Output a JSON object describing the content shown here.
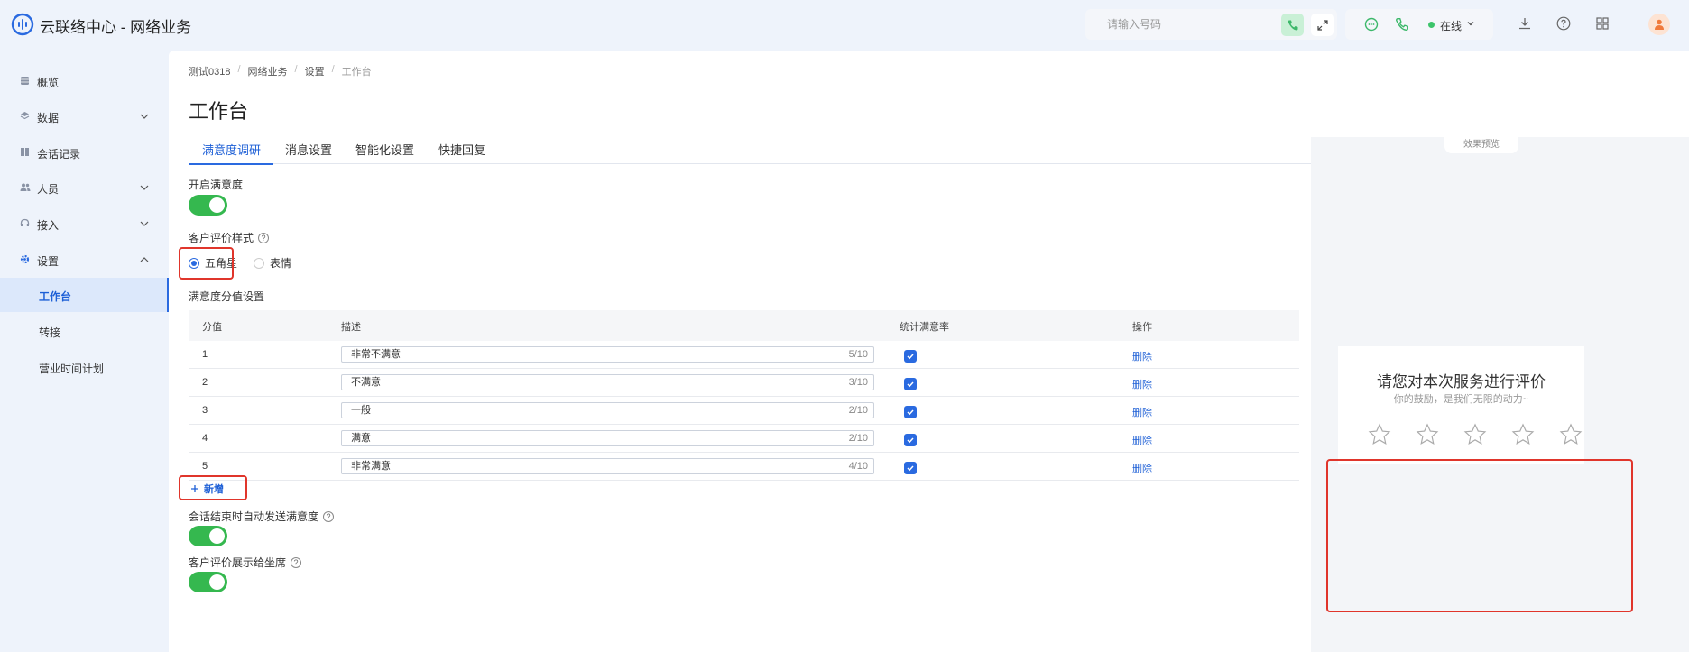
{
  "header": {
    "app_title": "云联络中心 - 网络业务",
    "phone_placeholder": "请输入号码",
    "status": "在线"
  },
  "sidebar": {
    "items": [
      {
        "label": "概览"
      },
      {
        "label": "数据"
      },
      {
        "label": "会话记录"
      },
      {
        "label": "人员"
      },
      {
        "label": "接入"
      },
      {
        "label": "设置"
      },
      {
        "label": "工作台"
      },
      {
        "label": "转接"
      },
      {
        "label": "营业时间计划"
      }
    ]
  },
  "breadcrumb": [
    "测试0318",
    "网络业务",
    "设置",
    "工作台"
  ],
  "page_title": "工作台",
  "tabs": [
    "满意度调研",
    "消息设置",
    "智能化设置",
    "快捷回复"
  ],
  "form": {
    "enable_label": "开启满意度",
    "style_label": "客户评价样式",
    "style_options": [
      "五角星",
      "表情"
    ],
    "score_settings_label": "满意度分值设置",
    "auto_send_label": "会话结束时自动发送满意度",
    "show_agent_label": "客户评价展示给坐席"
  },
  "table": {
    "headers": [
      "分值",
      "描述",
      "统计满意率",
      "操作"
    ],
    "rows": [
      {
        "score": "1",
        "desc": "非常不满意",
        "count": "5/10",
        "action": "删除"
      },
      {
        "score": "2",
        "desc": "不满意",
        "count": "3/10",
        "action": "删除"
      },
      {
        "score": "3",
        "desc": "一般",
        "count": "2/10",
        "action": "删除"
      },
      {
        "score": "4",
        "desc": "满意",
        "count": "2/10",
        "action": "删除"
      },
      {
        "score": "5",
        "desc": "非常满意",
        "count": "4/10",
        "action": "删除"
      }
    ],
    "add_label": "新增"
  },
  "preview": {
    "tab_label": "效果预览",
    "title": "请您对本次服务进行评价",
    "subtitle": "你的鼓励，是我们无限的动力~"
  },
  "colors": {
    "accent": "#2a6ae0",
    "toggle_on": "#35b84f",
    "highlight": "#e0352b"
  }
}
